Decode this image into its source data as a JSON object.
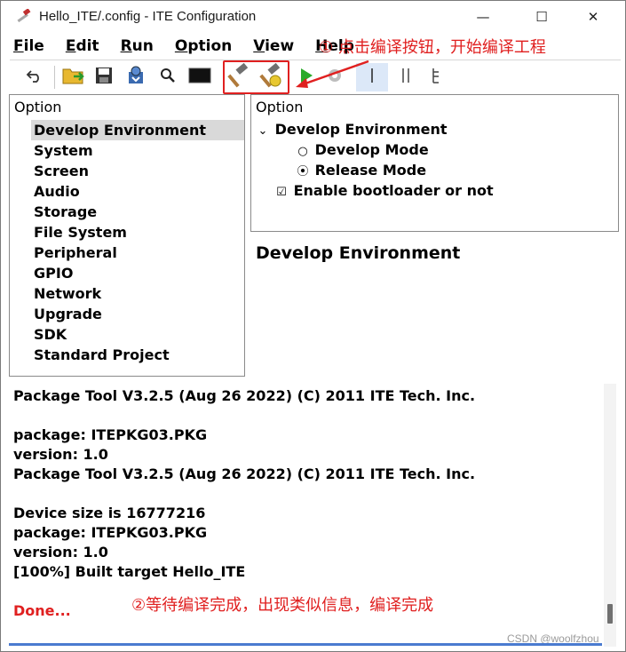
{
  "window": {
    "title": "Hello_ITE/.config - ITE Configuration",
    "minimize_glyph": "—",
    "maximize_glyph": "☐",
    "close_glyph": "✕"
  },
  "menu": {
    "items": [
      {
        "first": "F",
        "rest": "ile"
      },
      {
        "first": "E",
        "rest": "dit"
      },
      {
        "first": "R",
        "rest": "un"
      },
      {
        "first": "O",
        "rest": "ption"
      },
      {
        "first": "V",
        "rest": "iew"
      },
      {
        "first": "H",
        "rest": "elp"
      }
    ]
  },
  "annotations": {
    "step1": "① 点击编译按钮，开始编译工程",
    "step2": "②等待编译完成，出现类似信息，编译完成"
  },
  "toolbar": {
    "icons": [
      "undo-icon",
      "open-folder-icon",
      "save-icon",
      "import-icon",
      "search-icon",
      "terminal-icon",
      "build-hammer-icon",
      "rebuild-hammer-icon",
      "run-icon",
      "settings-icon",
      "single-view-icon",
      "split-view-icon",
      "tree-view-icon"
    ]
  },
  "left_panel": {
    "heading": "Option",
    "items": [
      "Develop Environment",
      "System",
      "Screen",
      "Audio",
      "Storage",
      "File System",
      "Peripheral",
      "GPIO",
      "Network",
      "Upgrade",
      "SDK",
      "Standard Project"
    ],
    "selected_index": 0
  },
  "right_panel": {
    "heading": "Option",
    "group_label": "Develop Environment",
    "expand_glyph": "⌄",
    "radio_options": [
      {
        "label": "Develop Mode",
        "glyph": "○"
      },
      {
        "label": "Release Mode",
        "glyph": "⦿"
      }
    ],
    "checkbox": {
      "label": "Enable bootloader or not",
      "glyph": "☑"
    }
  },
  "description": {
    "title": "Develop Environment"
  },
  "log": {
    "lines": [
      "Package Tool V3.2.5 (Aug 26 2022) (C) 2011 ITE Tech. Inc.",
      "",
      "package: ITEPKG03.PKG",
      "version: 1.0",
      "Package Tool V3.2.5 (Aug 26 2022) (C) 2011 ITE Tech. Inc.",
      "",
      "Device size is 16777216",
      "package: ITEPKG03.PKG",
      "version: 1.0",
      "[100%] Built target Hello_ITE",
      "",
      "Done..."
    ]
  },
  "watermark": "CSDN @woolfzhou",
  "colors": {
    "annotation_red": "#e02020",
    "selected_bg": "#d9d9d9",
    "scroll_thumb": "#707070"
  }
}
